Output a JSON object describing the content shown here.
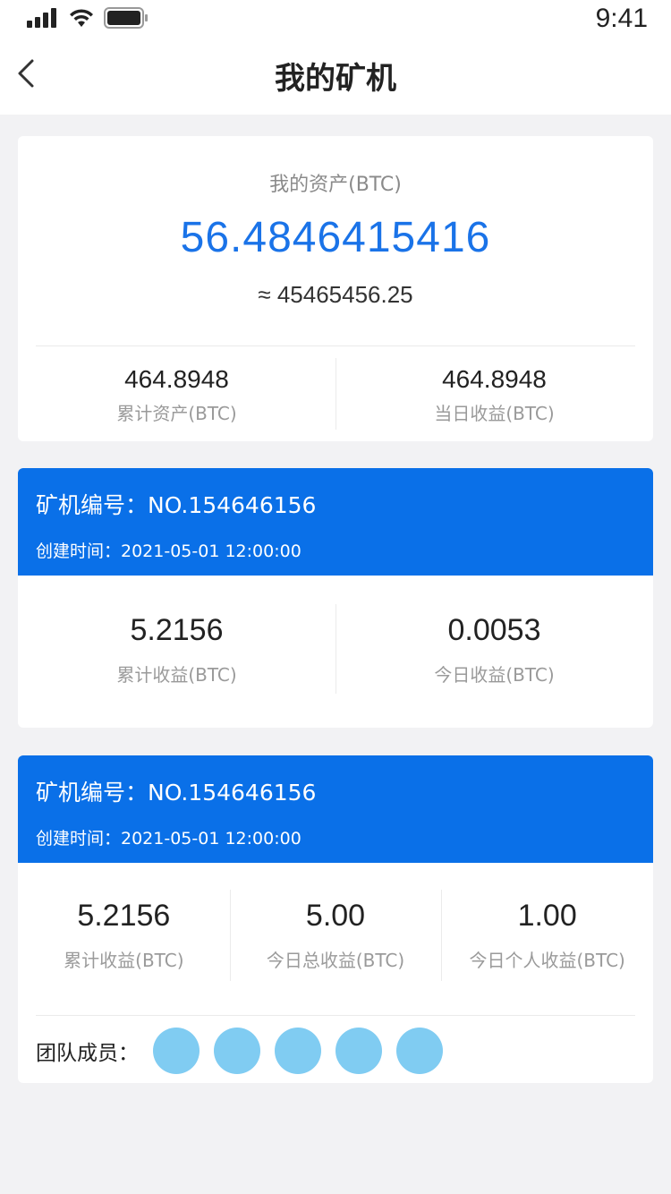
{
  "status_bar": {
    "time": "9:41"
  },
  "nav": {
    "title": "我的矿机"
  },
  "assets": {
    "label": "我的资产(BTC)",
    "value": "56.4846415416",
    "approx": "≈ 45465456.25",
    "stats": [
      {
        "value": "464.8948",
        "label": "累计资产(BTC)"
      },
      {
        "value": "464.8948",
        "label": "当日收益(BTC)"
      }
    ]
  },
  "miners": [
    {
      "id": "矿机编号：NO.154646156",
      "created": "创建时间：2021-05-01 12:00:00",
      "stats": [
        {
          "value": "5.2156",
          "label": "累计收益(BTC)"
        },
        {
          "value": "0.0053",
          "label": "今日收益(BTC)"
        }
      ]
    },
    {
      "id": "矿机编号：NO.154646156",
      "created": "创建时间：2021-05-01 12:00:00",
      "stats": [
        {
          "value": "5.2156",
          "label": "累计收益(BTC)"
        },
        {
          "value": "5.00",
          "label": "今日总收益(BTC)"
        },
        {
          "value": "1.00",
          "label": "今日个人收益(BTC)"
        }
      ],
      "team": {
        "label": "团队成员：",
        "avatar_color": "#80ccf2",
        "member_count": 5
      }
    }
  ],
  "colors": {
    "accent": "#0a70e8",
    "asset_value": "#1a73e8",
    "background": "#f2f2f4"
  }
}
